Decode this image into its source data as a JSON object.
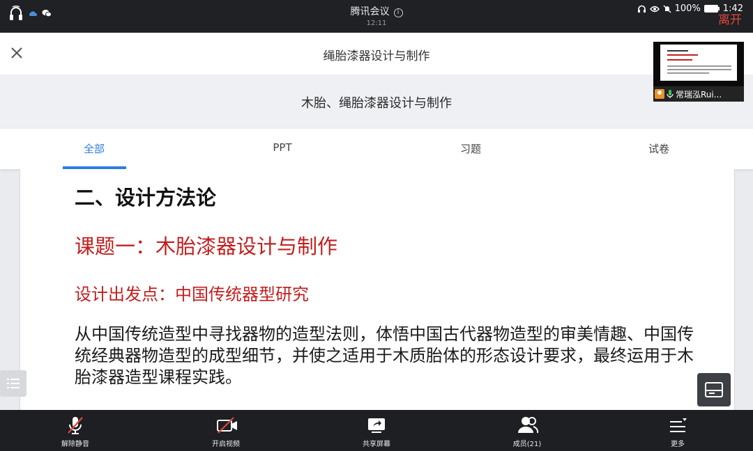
{
  "status_bar": {
    "app_title": "腾讯会议",
    "meeting_time": "12:11",
    "battery": "100%",
    "clock": "1:42",
    "leave_label": "离开"
  },
  "header": {
    "doc_title": "绳胎漆器设计与制作",
    "subtitle": "木胎、绳胎漆器设计与制作"
  },
  "video_thumb": {
    "participant_name": "常瑞泓Rui..."
  },
  "tabs": [
    {
      "label": "全部",
      "active": true
    },
    {
      "label": "PPT",
      "active": false
    },
    {
      "label": "习题",
      "active": false
    },
    {
      "label": "试卷",
      "active": false
    }
  ],
  "slide": {
    "heading": "二、设计方法论",
    "topic": "课题一：木胎漆器设计与制作",
    "starting_point": "设计出发点：中国传统器型研究",
    "body": "从中国传统造型中寻找器物的造型法则，体悟中国古代器物造型的审美情趣、中国传统经典器物造型的成型细节，并使之适用于木质胎体的形态设计要求，最终运用于木胎漆器造型课程实践。"
  },
  "toolbar": {
    "unmute": "解除静音",
    "start_video": "开启视频",
    "share_screen": "共享屏幕",
    "members": "成员(21)",
    "more": "更多"
  },
  "colors": {
    "accent": "#2f7de1",
    "slide_red": "#c21e1e",
    "leave_red": "#e0463c"
  }
}
